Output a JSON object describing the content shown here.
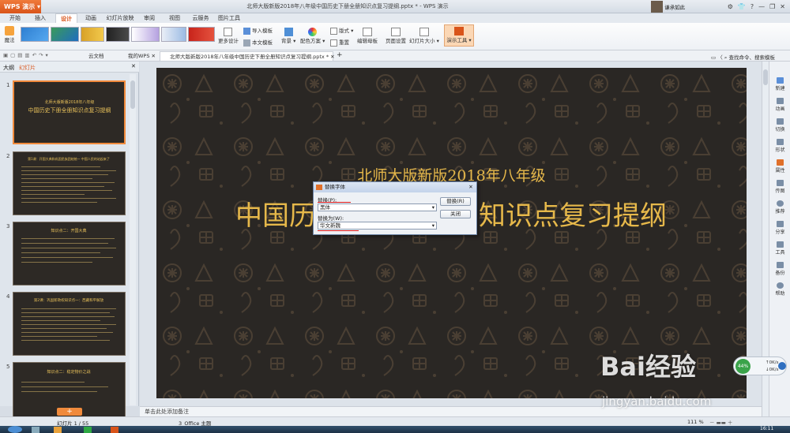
{
  "app": {
    "name": "WPS 演示",
    "document_title": "北师大版新版2018年八年级中国历史下册全册知识点复习提纲.pptx * - WPS 演示",
    "user_name": "谦承如此"
  },
  "tabs": [
    "开始",
    "插入",
    "设计",
    "动画",
    "幻灯片放映",
    "审阅",
    "视图",
    "云服务",
    "图片工具"
  ],
  "active_tab": "设计",
  "ribbon": {
    "magic": "魔法",
    "more_design": "更多设计",
    "import_template": "导入模板",
    "text_template": "本文模板",
    "background": "背景",
    "color_scheme": "配色方案",
    "layout": "版式",
    "reset": "重置",
    "edit_master": "编辑母板",
    "page_setup": "页面设置",
    "slide_size": "幻灯片大小",
    "presentation_tools": "演示工具"
  },
  "quick_access": {
    "cloud_docs": "云文档",
    "my_wps": "我的WPS",
    "doc_tab": "北师大版新版2018年八年级中国历史下册全册知识点复习提纲.pptx *",
    "search_placeholder": "查找命令、搜索模板"
  },
  "left_panel": {
    "tab_outline": "大纲",
    "tab_slides": "幻灯片",
    "slides": [
      {
        "num": "1",
        "subtitle": "北师大版新版2018年八年级",
        "title": "中国历史下册全册知识点复习提纲"
      },
      {
        "num": "2",
        "title": "第1课：开国大典和巩固民族团结统一 中国人民的站起来了"
      },
      {
        "num": "3",
        "title": "知识点二：开国大典"
      },
      {
        "num": "4",
        "title": "第2课：巩固新政权知识点一：西藏和平解放"
      },
      {
        "num": "5",
        "title": "知识点二：稳定物价之战"
      }
    ]
  },
  "slide": {
    "subtitle": "北师大版新版2018年八年级",
    "title_left": "中国历",
    "title_right": "知识点复习提纲"
  },
  "dialog": {
    "title": "替换字体",
    "replace_label": "替换(P):",
    "replace_value": "黑体",
    "with_label": "替换为(W):",
    "with_value": "华文新魏",
    "replace_button": "替换(R)",
    "close_button": "关闭"
  },
  "notes_placeholder": "单击此处添加备注",
  "sidebar": [
    "新建",
    "动画",
    "切换",
    "形状",
    "属性",
    "传图",
    "推荐",
    "分享",
    "工具",
    "备份",
    "帮助"
  ],
  "status": {
    "slide_count": "幻灯片 1 / 55",
    "theme": "3_Office 主题",
    "zoom": "111 %"
  },
  "network": {
    "percent": "44%",
    "up": "0K/s",
    "down": "0K/s"
  },
  "clock": "16:11",
  "watermark": {
    "brand": "Bai经验",
    "url": "jingyan.baidu.com"
  },
  "colors": {
    "accent": "#d9541a",
    "slide_bg": "#2a2724",
    "slide_text": "#e6b84a",
    "redline": "#e01818"
  }
}
